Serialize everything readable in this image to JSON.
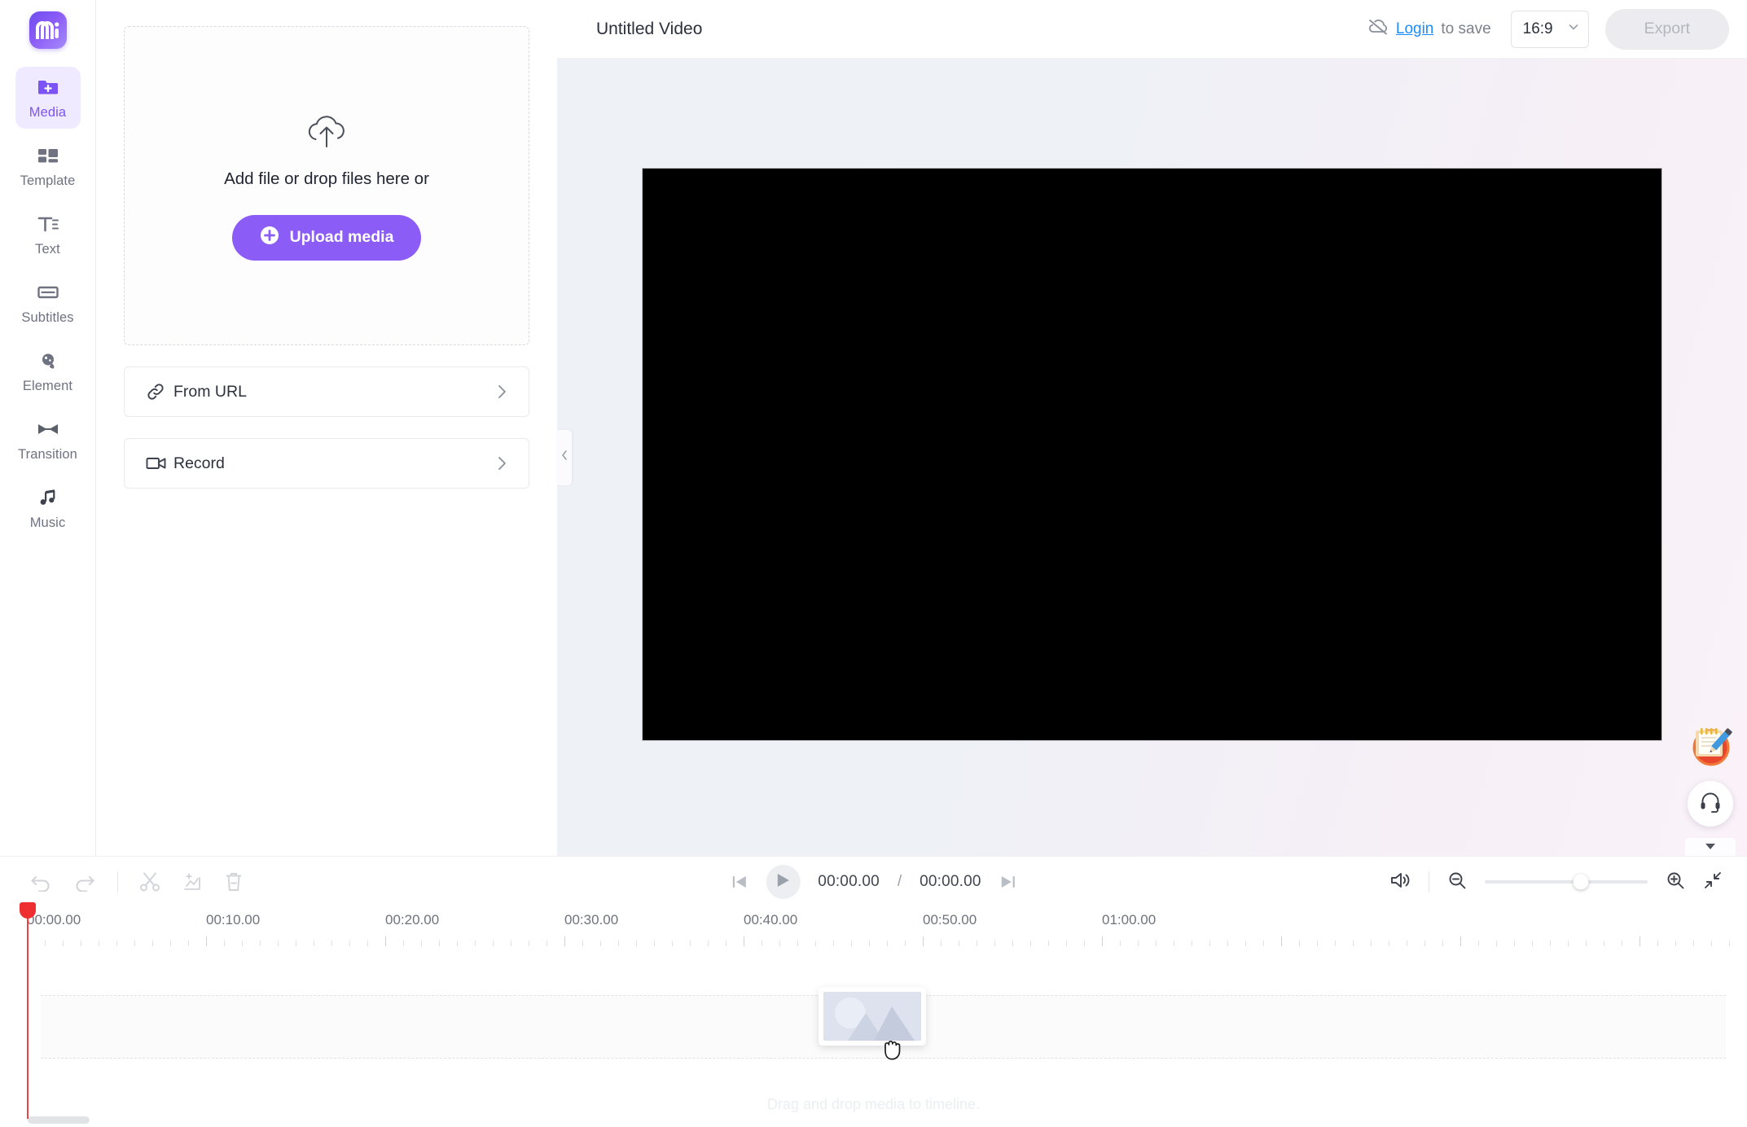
{
  "brand": {
    "logo_text": "mi",
    "accent": "#8b5cf6"
  },
  "sidebar": {
    "items": [
      {
        "label": "Media",
        "icon": "media-add-icon",
        "active": true
      },
      {
        "label": "Template",
        "icon": "template-icon",
        "active": false
      },
      {
        "label": "Text",
        "icon": "text-icon",
        "active": false
      },
      {
        "label": "Subtitles",
        "icon": "subtitles-icon",
        "active": false
      },
      {
        "label": "Element",
        "icon": "element-icon",
        "active": false
      },
      {
        "label": "Transition",
        "icon": "transition-icon",
        "active": false
      },
      {
        "label": "Music",
        "icon": "music-icon",
        "active": false
      }
    ]
  },
  "media_panel": {
    "dropzone": {
      "icon": "cloud-upload-icon",
      "text": "Add file or drop files here or",
      "upload_button": "Upload media",
      "upload_button_icon": "plus-circle-icon"
    },
    "rows": [
      {
        "label": "From URL",
        "icon": "link-icon",
        "chevron": "chevron-right-icon"
      },
      {
        "label": "Record",
        "icon": "camera-icon",
        "chevron": "chevron-right-icon"
      }
    ]
  },
  "header": {
    "title": "Untitled Video",
    "cloud_icon": "cloud-off-icon",
    "login_link": "Login",
    "login_suffix": "to save",
    "aspect_ratio": "16:9",
    "aspect_chevron": "chevron-down-icon",
    "export_label": "Export",
    "collapse_icon": "chevron-left-icon"
  },
  "floating": {
    "note_icon": "notepad-pencil-icon",
    "help_icon": "headset-icon",
    "collapse_icon": "chevron-down-icon"
  },
  "timeline": {
    "tools": [
      {
        "name": "undo-button",
        "icon": "undo-icon"
      },
      {
        "name": "redo-button",
        "icon": "redo-icon"
      },
      {
        "name": "split-button",
        "icon": "scissors-icon"
      },
      {
        "name": "crop-button",
        "icon": "image-add-icon"
      },
      {
        "name": "delete-button",
        "icon": "trash-icon"
      }
    ],
    "transport": {
      "prev_icon": "skip-previous-icon",
      "play_icon": "play-icon",
      "next_icon": "skip-next-icon",
      "current_time": "00:00.00",
      "separator": "/",
      "total_time": "00:00.00"
    },
    "right_controls": {
      "volume_icon": "volume-icon",
      "zoom_out_icon": "zoom-out-icon",
      "zoom_in_icon": "zoom-in-icon",
      "fit_icon": "collapse-diagonal-icon",
      "zoom_value": 60
    },
    "ruler_labels": [
      "00:00.00",
      "00:10.00",
      "00:20.00",
      "00:30.00",
      "00:40.00",
      "00:50.00",
      "01:00.00"
    ],
    "hint": "Drag and drop media to timeline.",
    "playhead_time": "00:00.00",
    "drag_ghost": {
      "icon": "image-placeholder-icon",
      "cursor": "grab-cursor"
    }
  }
}
